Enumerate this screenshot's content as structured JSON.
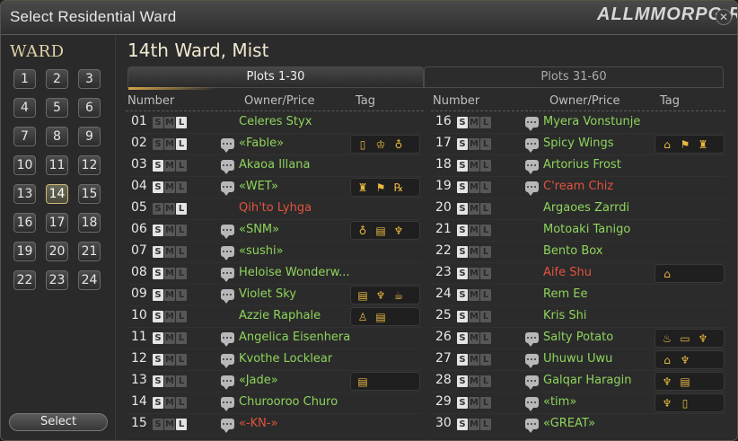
{
  "window": {
    "title": "Select Residential Ward",
    "watermark": "ALLMMORPG.RU",
    "close_label": "✕"
  },
  "sidebar": {
    "ward_heading": "WARD",
    "wards": [
      "1",
      "2",
      "3",
      "4",
      "5",
      "6",
      "7",
      "8",
      "9",
      "10",
      "11",
      "12",
      "13",
      "14",
      "15",
      "16",
      "17",
      "18",
      "19",
      "20",
      "21",
      "22",
      "23",
      "24"
    ],
    "selected_ward": "14",
    "select_label": "Select"
  },
  "main": {
    "ward_title": "14th Ward, Mist",
    "tabs": [
      {
        "label": "Plots 1-30",
        "active": true
      },
      {
        "label": "Plots 31-60",
        "active": false
      }
    ],
    "headers": {
      "number": "Number",
      "owner": "Owner/Price",
      "tag": "Tag"
    },
    "size_letters": [
      "S",
      "M",
      "L"
    ]
  },
  "plots_left": [
    {
      "num": "01",
      "size": "L",
      "chat": false,
      "owner": "Celeres Styx",
      "red": false,
      "tags": []
    },
    {
      "num": "02",
      "size": "L",
      "chat": true,
      "owner": "«Fable»",
      "red": false,
      "tags": [
        "door-icon",
        "crown-icon",
        "bell-icon"
      ]
    },
    {
      "num": "03",
      "size": "S",
      "chat": true,
      "owner": "Akaoa Illana",
      "red": false,
      "tags": []
    },
    {
      "num": "04",
      "size": "S",
      "chat": true,
      "owner": "«WET»",
      "red": false,
      "tags": [
        "bottle-icon",
        "flag-icon",
        "rp-icon"
      ]
    },
    {
      "num": "05",
      "size": "L",
      "chat": false,
      "owner": "Qih'to Lyhga",
      "red": true,
      "tags": []
    },
    {
      "num": "06",
      "size": "S",
      "chat": true,
      "owner": "«SNM»",
      "red": false,
      "tags": [
        "bell-icon",
        "book-icon",
        "dancer-icon"
      ]
    },
    {
      "num": "07",
      "size": "S",
      "chat": true,
      "owner": "«sushi»",
      "red": false,
      "tags": []
    },
    {
      "num": "08",
      "size": "S",
      "chat": true,
      "owner": "Heloise Wonderw...",
      "red": false,
      "tags": []
    },
    {
      "num": "09",
      "size": "S",
      "chat": true,
      "owner": "Violet Sky",
      "red": false,
      "tags": [
        "book-icon",
        "dancer-icon",
        "cup-icon"
      ]
    },
    {
      "num": "10",
      "size": "S",
      "chat": false,
      "owner": "Azzie Raphale",
      "red": false,
      "tags": [
        "chess-icon",
        "book-icon"
      ]
    },
    {
      "num": "11",
      "size": "S",
      "chat": true,
      "owner": "Angelica Eisenhera",
      "red": false,
      "tags": []
    },
    {
      "num": "12",
      "size": "S",
      "chat": true,
      "owner": "Kvothe Locklear",
      "red": false,
      "tags": []
    },
    {
      "num": "13",
      "size": "S",
      "chat": true,
      "owner": "«Jade»",
      "red": false,
      "tags": [
        "book-icon"
      ]
    },
    {
      "num": "14",
      "size": "S",
      "chat": true,
      "owner": "Churooroo Churo",
      "red": false,
      "tags": []
    },
    {
      "num": "15",
      "size": "L",
      "chat": true,
      "owner": "«-KN-»",
      "red": true,
      "tags": []
    }
  ],
  "plots_right": [
    {
      "num": "16",
      "size": "S",
      "chat": true,
      "owner": "Myera Vonstunje",
      "red": false,
      "tags": []
    },
    {
      "num": "17",
      "size": "S",
      "chat": true,
      "owner": "Spicy Wings",
      "red": false,
      "tags": [
        "house-icon",
        "flag-icon",
        "bottle-icon"
      ]
    },
    {
      "num": "18",
      "size": "S",
      "chat": true,
      "owner": "Artorius Frost",
      "red": false,
      "tags": []
    },
    {
      "num": "19",
      "size": "S",
      "chat": true,
      "owner": "C'ream Chiz",
      "red": true,
      "tags": []
    },
    {
      "num": "20",
      "size": "S",
      "chat": false,
      "owner": "Argaoes Zarrdi",
      "red": false,
      "tags": []
    },
    {
      "num": "21",
      "size": "S",
      "chat": false,
      "owner": "Motoaki Tanigo",
      "red": false,
      "tags": []
    },
    {
      "num": "22",
      "size": "S",
      "chat": false,
      "owner": "Bento Box",
      "red": false,
      "tags": []
    },
    {
      "num": "23",
      "size": "S",
      "chat": false,
      "owner": "Aife Shu",
      "red": true,
      "tags": [
        "house-icon"
      ]
    },
    {
      "num": "24",
      "size": "S",
      "chat": false,
      "owner": "Rem Ee",
      "red": false,
      "tags": []
    },
    {
      "num": "25",
      "size": "S",
      "chat": false,
      "owner": "Kris Shi",
      "red": false,
      "tags": []
    },
    {
      "num": "26",
      "size": "S",
      "chat": true,
      "owner": "Salty Potato",
      "red": false,
      "tags": [
        "cake-icon",
        "bed-icon",
        "dancer-icon"
      ]
    },
    {
      "num": "27",
      "size": "S",
      "chat": true,
      "owner": "Uhuwu Uwu",
      "red": false,
      "tags": [
        "house-icon",
        "dancer-icon"
      ]
    },
    {
      "num": "28",
      "size": "S",
      "chat": true,
      "owner": "Galqar Haragin",
      "red": false,
      "tags": [
        "dancer-icon",
        "book-icon"
      ]
    },
    {
      "num": "29",
      "size": "S",
      "chat": true,
      "owner": "«tim»",
      "red": false,
      "tags": [
        "dancer-icon",
        "door-icon"
      ]
    },
    {
      "num": "30",
      "size": "S",
      "chat": true,
      "owner": "«GREAT»",
      "red": false,
      "tags": []
    }
  ],
  "tag_glyphs": {
    "door-icon": "▯",
    "crown-icon": "♔",
    "bell-icon": "♁",
    "bottle-icon": "♜",
    "flag-icon": "⚑",
    "rp-icon": "℞",
    "book-icon": "▤",
    "dancer-icon": "♆",
    "cup-icon": "☕",
    "chess-icon": "♙",
    "house-icon": "⌂",
    "cake-icon": "♨",
    "bed-icon": "▭"
  },
  "colors": {
    "owner_green": "#8ed45c",
    "owner_red": "#e0533e",
    "tag_gold": "#e8b840",
    "accent": "#d2a24a"
  }
}
